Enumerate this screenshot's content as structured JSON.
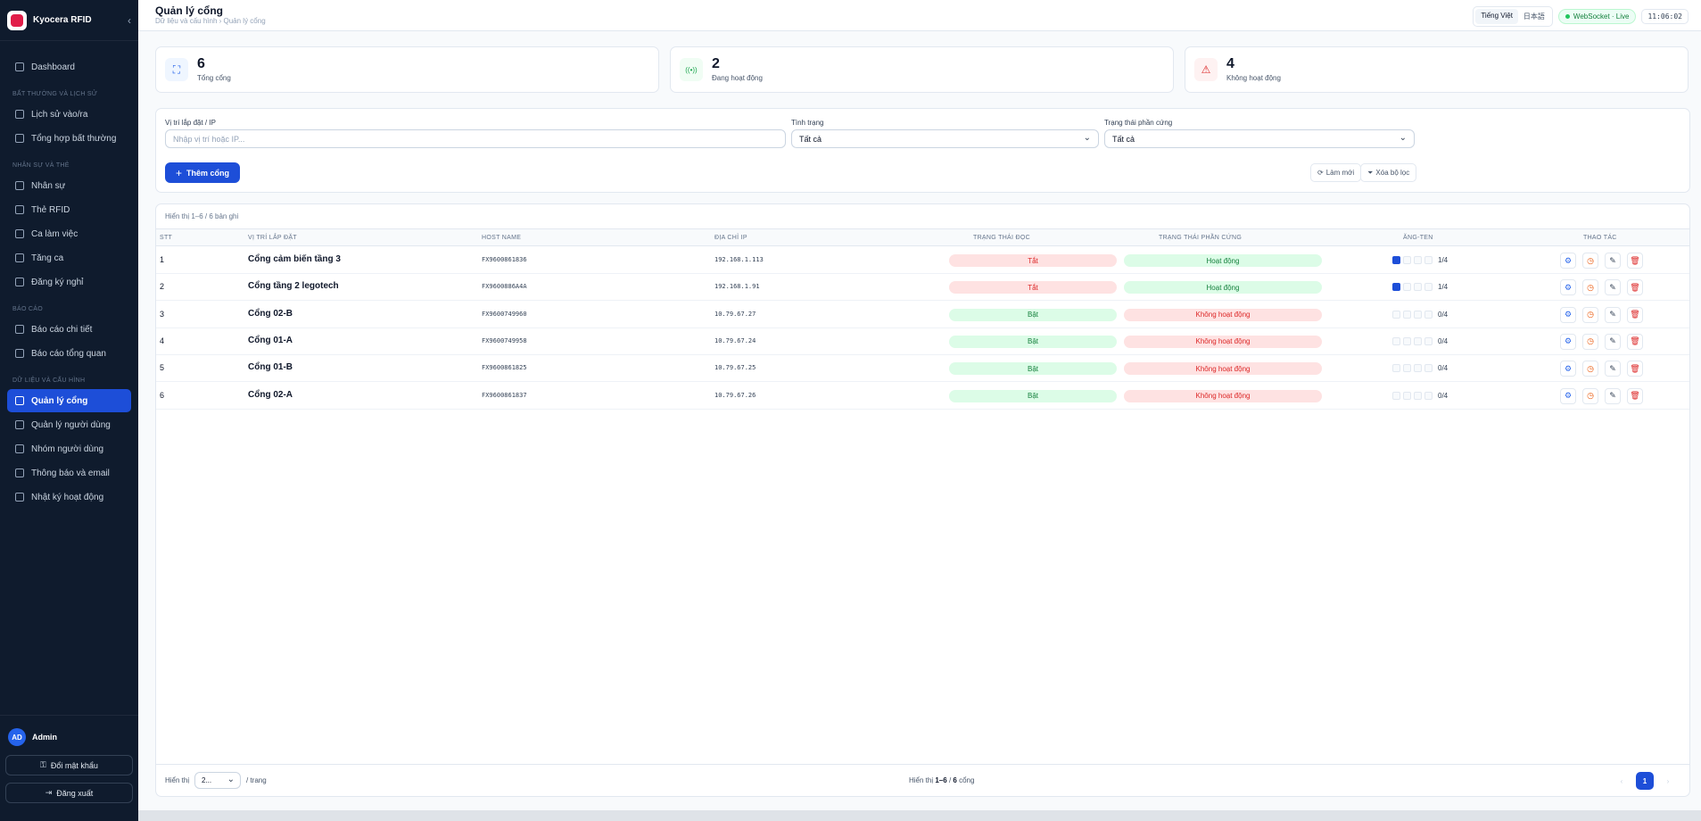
{
  "app": {
    "name": "Kyocera RFID"
  },
  "sidebar": {
    "dashboard": "Dashboard",
    "sections": [
      {
        "title": "BẤT THƯỜNG VÀ LỊCH SỬ",
        "items": [
          "Lịch sử vào/ra",
          "Tổng hợp bất thường"
        ]
      },
      {
        "title": "NHÂN SỰ VÀ THẺ",
        "items": [
          "Nhân sự",
          "Thẻ RFID",
          "Ca làm việc",
          "Tăng ca",
          "Đăng ký nghỉ"
        ]
      },
      {
        "title": "BÁO CÁO",
        "items": [
          "Báo cáo chi tiết",
          "Báo cáo tổng quan"
        ]
      },
      {
        "title": "DỮ LIỆU VÀ CẤU HÌNH",
        "items": [
          "Quản lý cổng",
          "Quản lý người dùng",
          "Nhóm người dùng",
          "Thông báo và email",
          "Nhật ký hoạt động"
        ]
      }
    ],
    "active_item": "Quản lý cổng",
    "user": {
      "initials": "AD",
      "name": "Admin"
    },
    "change_password": "Đổi mật khẩu",
    "logout": "Đăng xuất"
  },
  "header": {
    "title": "Quản lý cổng",
    "breadcrumb": "Dữ liệu và cấu hình › Quản lý cổng",
    "languages": [
      "Tiếng Việt",
      "日本語"
    ],
    "active_language": "Tiếng Việt",
    "websocket": "WebSocket · Live",
    "clock": "11:06:02"
  },
  "stats": [
    {
      "value": "6",
      "label": "Tổng cổng",
      "icon": "scan-icon",
      "color": "#2563eb",
      "bg": "#eff6ff"
    },
    {
      "value": "2",
      "label": "Đang hoạt động",
      "icon": "signal-icon",
      "color": "#16a34a",
      "bg": "#f0fdf4"
    },
    {
      "value": "4",
      "label": "Không hoạt động",
      "icon": "warning-icon",
      "color": "#dc2626",
      "bg": "#fef2f2"
    }
  ],
  "filters": {
    "location_label": "Vị trí lắp đặt / IP",
    "location_placeholder": "Nhập vị trí hoặc IP...",
    "status_label": "Tình trạng",
    "status_value": "Tất cả",
    "hardware_label": "Trạng thái phần cứng",
    "hardware_value": "Tất cả",
    "add_button": "Thêm cổng",
    "refresh_button": "Làm mới",
    "clear_button": "Xóa bộ lọc"
  },
  "table": {
    "showing": "Hiển thị 1–6 / 6 bản ghi",
    "columns": [
      "STT",
      "VỊ TRÍ LẮP ĐẶT",
      "HOST NAME",
      "ĐỊA CHỈ IP",
      "TRẠNG THÁI ĐỌC",
      "TRẠNG THÁI PHẦN CỨNG",
      "ĂNG-TEN",
      "THAO TÁC"
    ],
    "rows": [
      {
        "stt": "1",
        "location": "Cổng cảm biến tầng 3",
        "host": "FX9600861836",
        "ip": "192.168.1.113",
        "read": "Tắt",
        "read_on": false,
        "hw": "Hoạt động",
        "hw_on": true,
        "antennas_active": 1,
        "antennas": "1/4"
      },
      {
        "stt": "2",
        "location": "Cổng tầng 2 legotech",
        "host": "FX9600886A4A",
        "ip": "192.168.1.91",
        "read": "Tắt",
        "read_on": false,
        "hw": "Hoạt động",
        "hw_on": true,
        "antennas_active": 1,
        "antennas": "1/4"
      },
      {
        "stt": "3",
        "location": "Cổng 02-B",
        "host": "FX9600749960",
        "ip": "10.79.67.27",
        "read": "Bật",
        "read_on": true,
        "hw": "Không hoạt động",
        "hw_on": false,
        "antennas_active": 0,
        "antennas": "0/4"
      },
      {
        "stt": "4",
        "location": "Cổng 01-A",
        "host": "FX9600749958",
        "ip": "10.79.67.24",
        "read": "Bật",
        "read_on": true,
        "hw": "Không hoạt động",
        "hw_on": false,
        "antennas_active": 0,
        "antennas": "0/4"
      },
      {
        "stt": "5",
        "location": "Cổng 01-B",
        "host": "FX9600861825",
        "ip": "10.79.67.25",
        "read": "Bật",
        "read_on": true,
        "hw": "Không hoạt động",
        "hw_on": false,
        "antennas_active": 0,
        "antennas": "0/4"
      },
      {
        "stt": "6",
        "location": "Cổng 02-A",
        "host": "FX9600861837",
        "ip": "10.79.67.26",
        "read": "Bật",
        "read_on": true,
        "hw": "Không hoạt động",
        "hw_on": false,
        "antennas_active": 0,
        "antennas": "0/4"
      }
    ]
  },
  "footer": {
    "show_label": "Hiển thị",
    "page_size": "2...",
    "per_page": "/ trang",
    "summary_prefix": "Hiển thị ",
    "summary_range": "1–6",
    "summary_mid": " / ",
    "summary_total": "6",
    "summary_suffix": " cổng",
    "current_page": "1",
    "prev": "‹",
    "next": "›"
  }
}
